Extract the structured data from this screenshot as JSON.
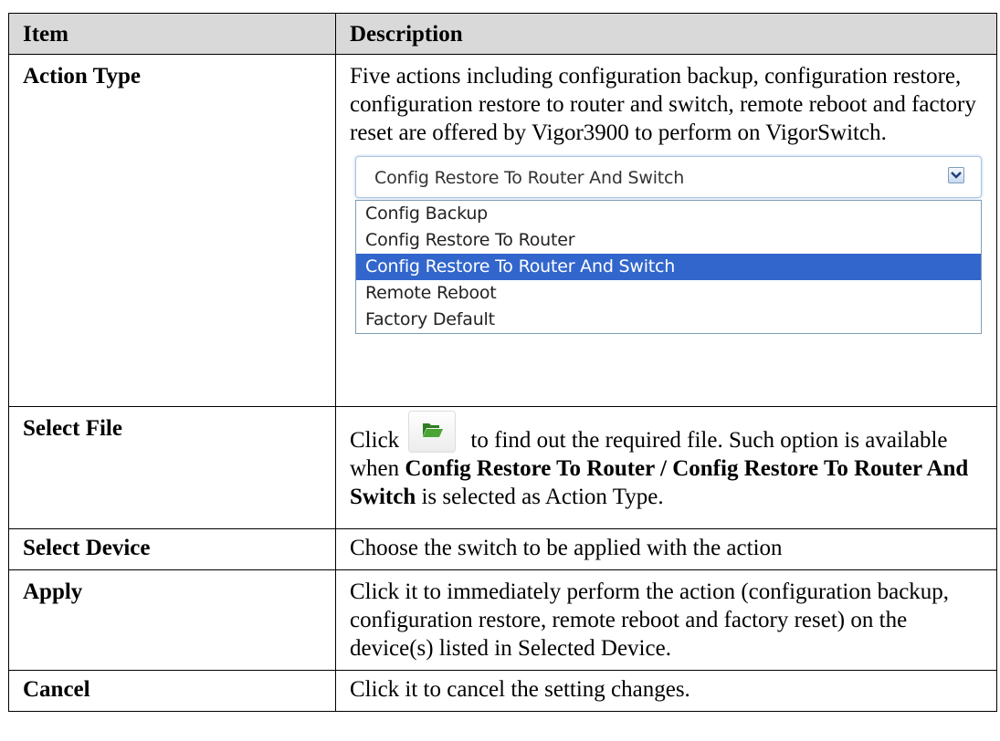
{
  "table": {
    "header": {
      "item": "Item",
      "description": "Description"
    },
    "rows": {
      "action_type": {
        "item": "Action Type",
        "text": "Five actions including configuration backup, configuration restore, configuration restore to router and switch, remote reboot and factory reset are offered by Vigor3900 to perform on VigorSwitch."
      },
      "select_file": {
        "item": "Select File",
        "pre": "Click",
        "mid": " to find out the required file. Such option is available when ",
        "bold": "Config Restore To Router / Config Restore To Router And Switch",
        "post": " is selected as Action Type."
      },
      "select_device": {
        "item": "Select Device",
        "text": "Choose the switch to be applied with the action"
      },
      "apply": {
        "item": "Apply",
        "text": "Click it to immediately perform the action (configuration backup, configuration restore, remote reboot and factory reset) on the device(s) listed in Selected Device."
      },
      "cancel": {
        "item": "Cancel",
        "text": "Click it to cancel the setting changes."
      }
    }
  },
  "dropdown": {
    "selected": "Config Restore To Router And Switch",
    "options": [
      "Config Backup",
      "Config Restore To Router",
      "Config Restore To Router And Switch",
      "Remote Reboot",
      "Factory Default"
    ],
    "highlight_color": "#3266cc"
  },
  "icons": {
    "dropdown_arrow": "chevron-down-icon",
    "folder": "folder-open-icon",
    "folder_color": "#3a8a2a"
  }
}
